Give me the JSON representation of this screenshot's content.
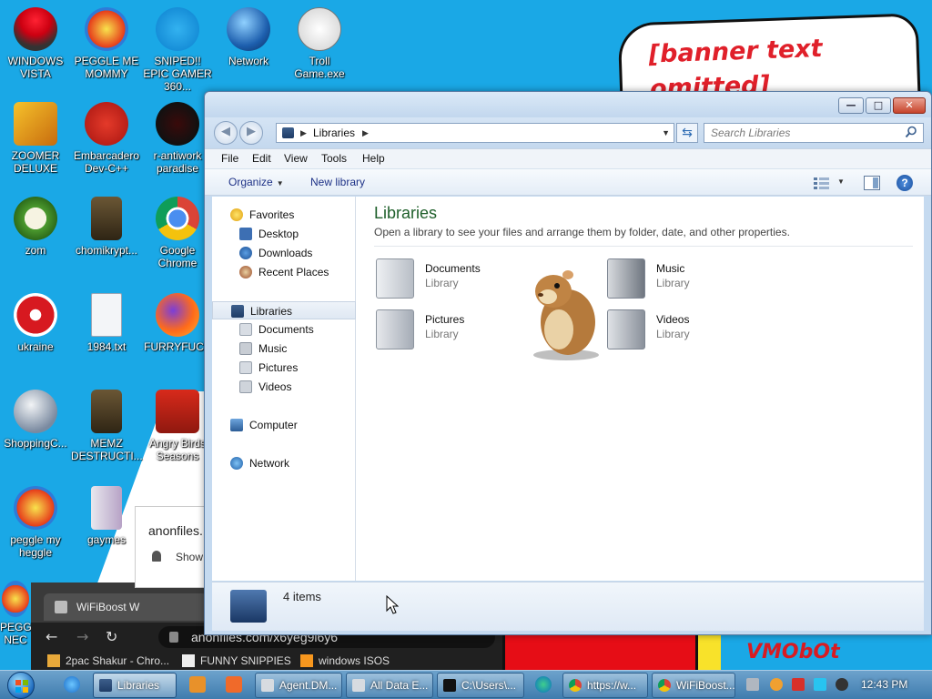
{
  "desktop": {
    "banner": "[banner text omitted]",
    "watermark": "VMObOt",
    "icons": [
      {
        "label": "WINDOWS VISTA",
        "icon": "vista-logo-icon"
      },
      {
        "label": "PEGGLE ME MOMMY",
        "icon": "peggle-icon"
      },
      {
        "label": "SNIPED!! EPIC GAMER 360...",
        "icon": "skype-icon"
      },
      {
        "label": "Network",
        "icon": "network-globe-icon"
      },
      {
        "label": "Troll Game.exe",
        "icon": "trollface-icon"
      },
      {
        "label": "ZOOMER DELUXE",
        "icon": "zuma-icon"
      },
      {
        "label": "Embarcadero Dev-C++",
        "icon": "devcpp-icon"
      },
      {
        "label": "r-antiwork paradise",
        "icon": "reddit-icon"
      },
      {
        "label": "zom",
        "icon": "plant-icon"
      },
      {
        "label": "chomikrypt...",
        "icon": "installer-icon"
      },
      {
        "label": "Google Chrome",
        "icon": "chrome-icon"
      },
      {
        "label": "ukraine",
        "icon": "radiation-icon"
      },
      {
        "label": "1984.txt",
        "icon": "text-file-icon"
      },
      {
        "label": "FURRYFUCK",
        "icon": "firefox-icon"
      },
      {
        "label": "ShoppingC...",
        "icon": "flash-icon"
      },
      {
        "label": "MEMZ DESTRUCTI...",
        "icon": "installer-icon"
      },
      {
        "label": "Angry Birds Seasons",
        "icon": "angry-birds-icon"
      },
      {
        "label": "peggle my heggle",
        "icon": "peggle-icon"
      },
      {
        "label": "gaymes",
        "icon": "media-folder-icon"
      },
      {
        "label": "PEGG NEC",
        "icon": "peggle-icon"
      }
    ]
  },
  "chrome": {
    "tab_title": "WiFiBoost W",
    "address": "anonfiles.com/x6yeg9i6y6",
    "bookmarks": [
      "2pac Shakur - Chro...",
      "FUNNY SNIPPIES",
      "windows ISOS"
    ]
  },
  "notification": {
    "title": "anonfiles.",
    "action": "Show"
  },
  "explorer": {
    "breadcrumb": "Libraries",
    "search_placeholder": "Search Libraries",
    "menu": [
      "File",
      "Edit",
      "View",
      "Tools",
      "Help"
    ],
    "commands": {
      "organize": "Organize",
      "new_library": "New library"
    },
    "nav": {
      "favorites": "Favorites",
      "fav_items": [
        "Desktop",
        "Downloads",
        "Recent Places"
      ],
      "libraries": "Libraries",
      "lib_items": [
        "Documents",
        "Music",
        "Pictures",
        "Videos"
      ],
      "computer": "Computer",
      "network": "Network"
    },
    "heading": "Libraries",
    "subheading": "Open a library to see your files and arrange them by folder, date, and other properties.",
    "libraries": [
      {
        "name": "Documents",
        "type": "Library"
      },
      {
        "name": "Music",
        "type": "Library"
      },
      {
        "name": "Pictures",
        "type": "Library"
      },
      {
        "name": "Videos",
        "type": "Library"
      }
    ],
    "status": "4 items"
  },
  "taskbar": {
    "buttons": [
      "Libraries",
      "Agent.DM...",
      "All Data E...",
      "C:\\Users\\...",
      "https://w...",
      "WiFiBoost..."
    ],
    "clock": "12:43 PM"
  },
  "colors": {
    "desktop_bg": "#1aa8e6",
    "heading_green": "#1e5f2a",
    "banner_red": "#e0202a"
  }
}
